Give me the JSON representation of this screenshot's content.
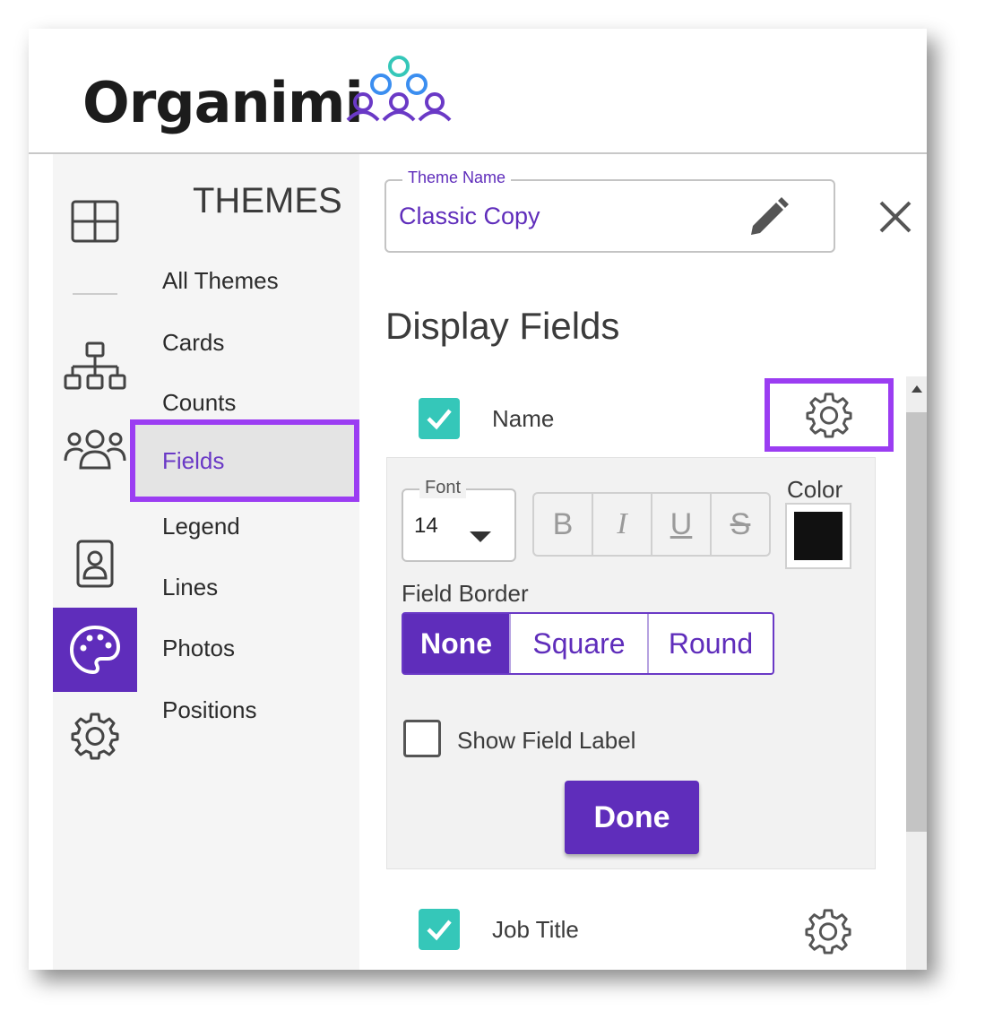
{
  "header": {
    "logo_text": "Organimi"
  },
  "rail": {
    "items": [
      "grid-icon",
      "org-chart-icon",
      "people-icon",
      "contact-card-icon",
      "palette-icon",
      "gear-icon"
    ],
    "active": "palette-icon"
  },
  "menu": {
    "title": "THEMES",
    "items": [
      "All Themes",
      "Cards",
      "Counts",
      "Fields",
      "Legend",
      "Lines",
      "Photos",
      "Positions"
    ],
    "selected": "Fields"
  },
  "panel": {
    "theme_name_label": "Theme Name",
    "theme_name_value": "Classic Copy",
    "section_title": "Display Fields",
    "fields": [
      {
        "label": "Name",
        "checked": true
      },
      {
        "label": "Job Title",
        "checked": true
      }
    ],
    "settings": {
      "font_label": "Font",
      "font_value": "14",
      "format_buttons": [
        "B",
        "I",
        "U",
        "S"
      ],
      "color_label": "Color",
      "color_value": "#111111",
      "border_label": "Field Border",
      "border_options": [
        "None",
        "Square",
        "Round"
      ],
      "border_selected": "None",
      "show_label_text": "Show Field Label",
      "show_label_checked": false,
      "done_label": "Done"
    }
  },
  "colors": {
    "accent": "#5f2dbb",
    "highlight": "#9b3df2",
    "check": "#35c7b9"
  }
}
